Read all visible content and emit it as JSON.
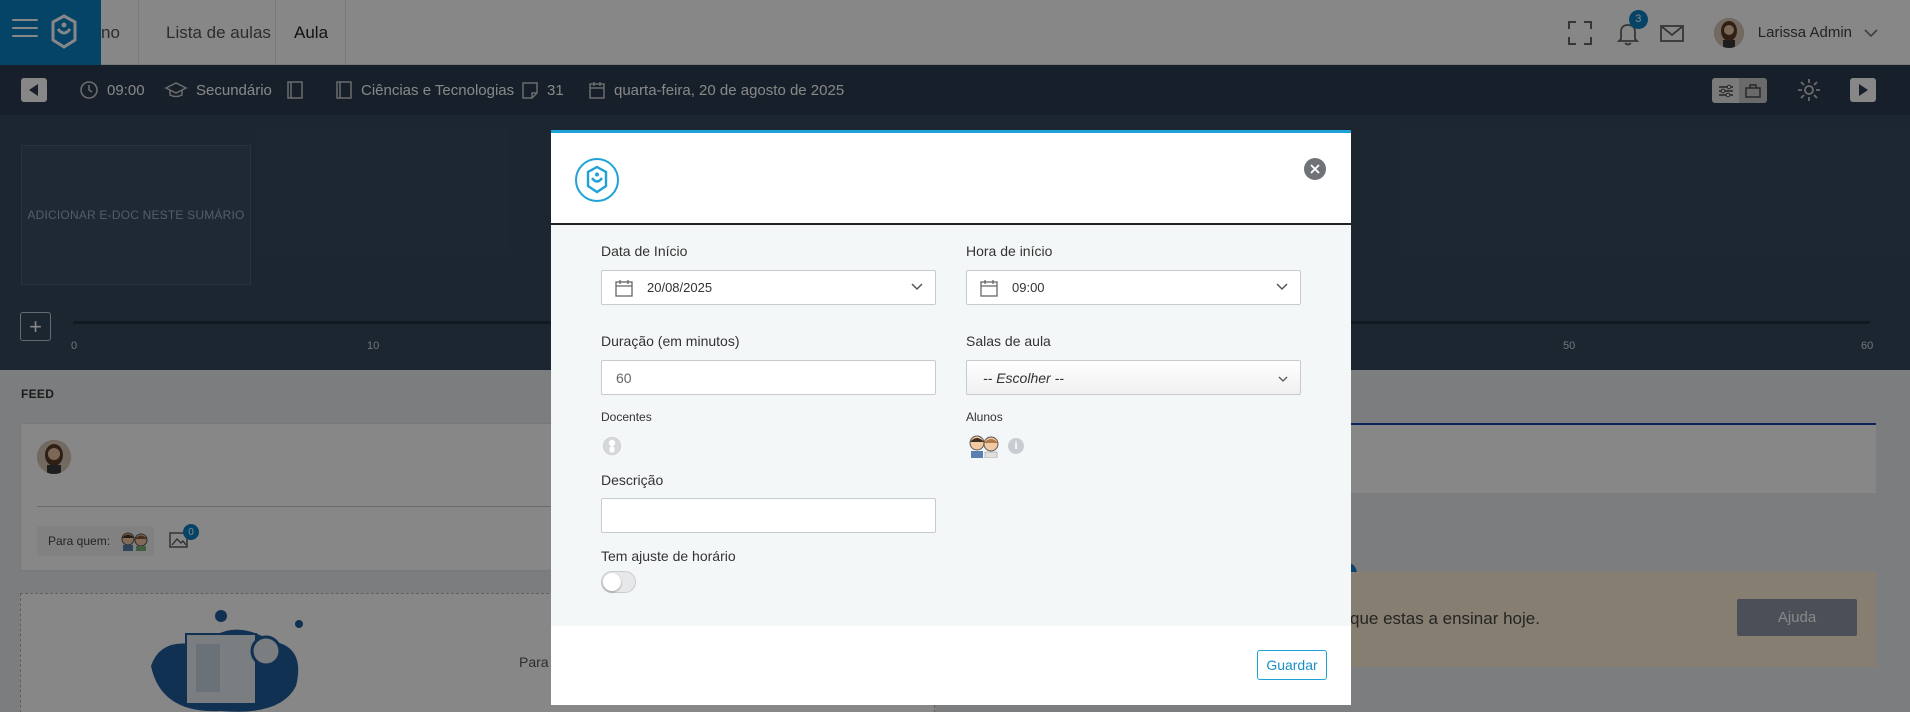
{
  "topbar": {
    "nav": [
      {
        "label": "no"
      },
      {
        "label": "Lista de aulas"
      },
      {
        "label": "Aula"
      }
    ],
    "notifications_count": "3",
    "user_name": "Larissa Admin"
  },
  "infobar": {
    "time": "09:00",
    "level": "Secundário",
    "subject": "Ciências e Tecnologias",
    "lesson_number": "31",
    "date": "quarta-feira, 20 de agosto de 2025"
  },
  "timeline": {
    "edoc_label": "ADICIONAR E-DOC NESTE SUMÁRIO",
    "add_label": "+",
    "ticks": [
      "0",
      "10",
      "50",
      "60"
    ]
  },
  "feed": {
    "title": "FEED",
    "para_quem_label": "Para quem:",
    "images_count": "0",
    "upload_text": "Para f",
    "help_text": "que estas a ensinar hoje.",
    "help_button": "Ajuda"
  },
  "modal": {
    "start_date_label": "Data de Início",
    "start_date_value": "20/08/2025",
    "start_time_label": "Hora de início",
    "start_time_value": "09:00",
    "duration_label": "Duração (em minutos)",
    "duration_value": "60",
    "rooms_label": "Salas de aula",
    "rooms_value": "-- Escolher --",
    "teachers_label": "Docentes",
    "students_label": "Alunos",
    "info_glyph": "i",
    "description_label": "Descrição",
    "description_value": "",
    "schedule_adjust_label": "Tem ajuste de horário",
    "save_button": "Guardar"
  },
  "colors": {
    "brand_blue": "#0a7fc2",
    "modal_accent": "#1fa2d8",
    "dark_bar": "#2c3e50"
  }
}
